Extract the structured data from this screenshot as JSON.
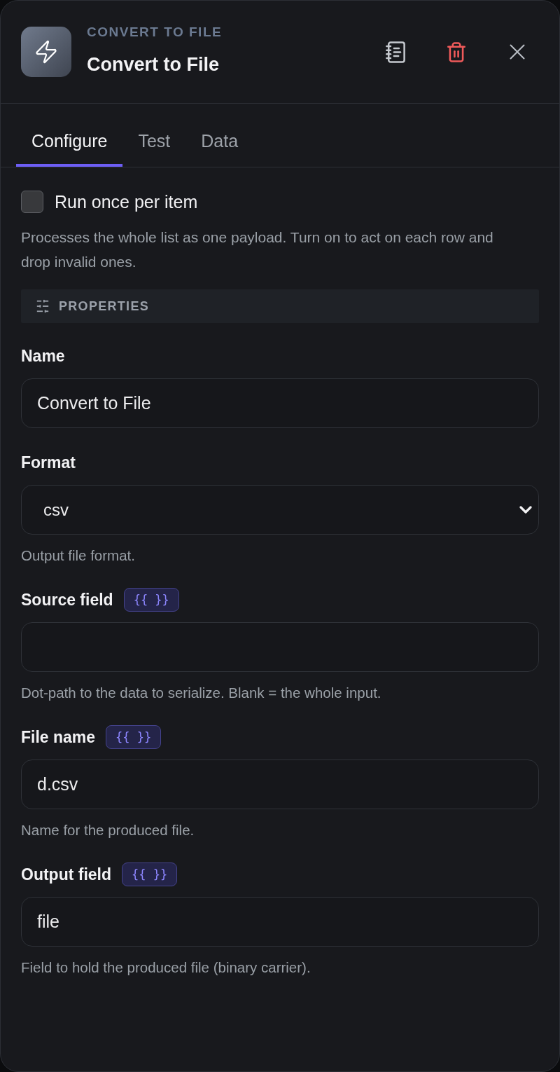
{
  "header": {
    "kicker": "CONVERT TO FILE",
    "title": "Convert to File"
  },
  "tabs": [
    {
      "label": "Configure",
      "selected": true
    },
    {
      "label": "Test",
      "selected": false
    },
    {
      "label": "Data",
      "selected": false
    }
  ],
  "run_once": {
    "label": "Run once per item",
    "checked": false,
    "description": "Processes the whole list as one payload. Turn on to act on each row and drop invalid ones."
  },
  "section": {
    "title": "PROPERTIES"
  },
  "fields": [
    {
      "kind": "text",
      "label": "Name",
      "value": "Convert to File"
    },
    {
      "kind": "select",
      "label": "Format",
      "value": "csv",
      "help": "Output file format."
    },
    {
      "kind": "text",
      "label": "Source field",
      "badge": "{{ }}",
      "help": "Dot-path to the data to serialize. Blank = the whole input."
    },
    {
      "kind": "text",
      "label": "File name",
      "badge": "{{ }}",
      "value": "d.csv",
      "help": "Name for the produced file."
    },
    {
      "kind": "text",
      "label": "Output field",
      "badge": "{{ }}",
      "value": "file",
      "help": "Field to hold the produced file (binary carrier)."
    }
  ]
}
